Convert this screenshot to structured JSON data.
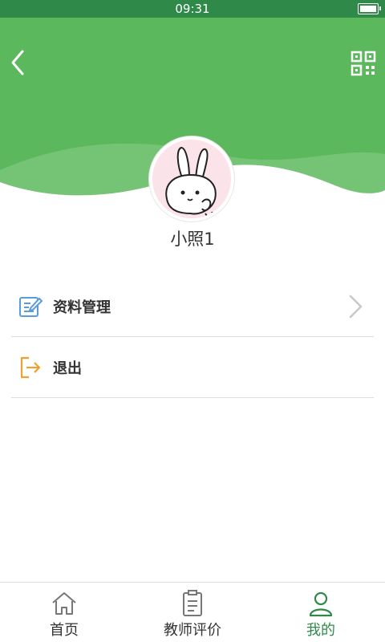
{
  "status_bar": {
    "time": "09:31"
  },
  "profile": {
    "username": "小照1"
  },
  "menu": {
    "items": [
      {
        "label": "资料管理",
        "icon": "edit-document-icon",
        "has_chevron": true
      },
      {
        "label": "退出",
        "icon": "logout-icon",
        "has_chevron": false
      }
    ]
  },
  "tab_bar": {
    "tabs": [
      {
        "label": "首页",
        "icon": "home-icon",
        "active": false
      },
      {
        "label": "教师评价",
        "icon": "clipboard-icon",
        "active": false
      },
      {
        "label": "我的",
        "icon": "user-icon",
        "active": true
      }
    ]
  },
  "colors": {
    "header_green": "#5cb85c",
    "status_green": "#2f8a4a",
    "active_tab": "#2f8a4a",
    "edit_icon": "#5a9be0",
    "logout_icon": "#f0a030"
  }
}
